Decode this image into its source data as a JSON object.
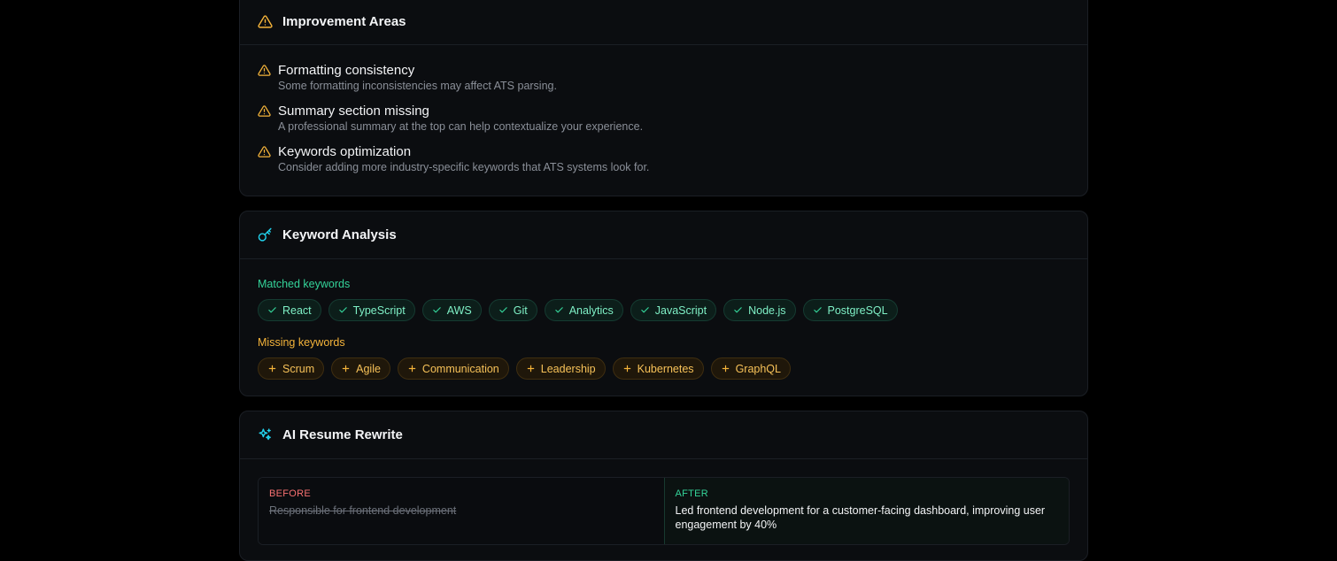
{
  "improvement": {
    "title": "Improvement Areas",
    "icon": "warning-triangle-icon",
    "color": "#f5b43a",
    "items": [
      {
        "title": "Formatting consistency",
        "desc": "Some formatting inconsistencies may affect ATS parsing."
      },
      {
        "title": "Summary section missing",
        "desc": "A professional summary at the top can help contextualize your experience."
      },
      {
        "title": "Keywords optimization",
        "desc": "Consider adding more industry-specific keywords that ATS systems look for."
      }
    ]
  },
  "keywords": {
    "title": "Keyword Analysis",
    "icon": "key-icon",
    "icon_color": "#22d3ee",
    "matched_label": "Matched keywords",
    "matched": [
      "React",
      "TypeScript",
      "AWS",
      "Git",
      "Analytics",
      "JavaScript",
      "Node.js",
      "PostgreSQL"
    ],
    "missing_label": "Missing keywords",
    "missing": [
      "Scrum",
      "Agile",
      "Communication",
      "Leadership",
      "Kubernetes",
      "GraphQL"
    ]
  },
  "rewrite": {
    "title": "AI Resume Rewrite",
    "icon": "sparkles-icon",
    "icon_color": "#22d3ee",
    "before_label": "BEFORE",
    "before_text": "Responsible for frontend development",
    "after_label": "AFTER",
    "after_text": "Led frontend development for a customer-facing dashboard, improving user engagement by 40%"
  }
}
